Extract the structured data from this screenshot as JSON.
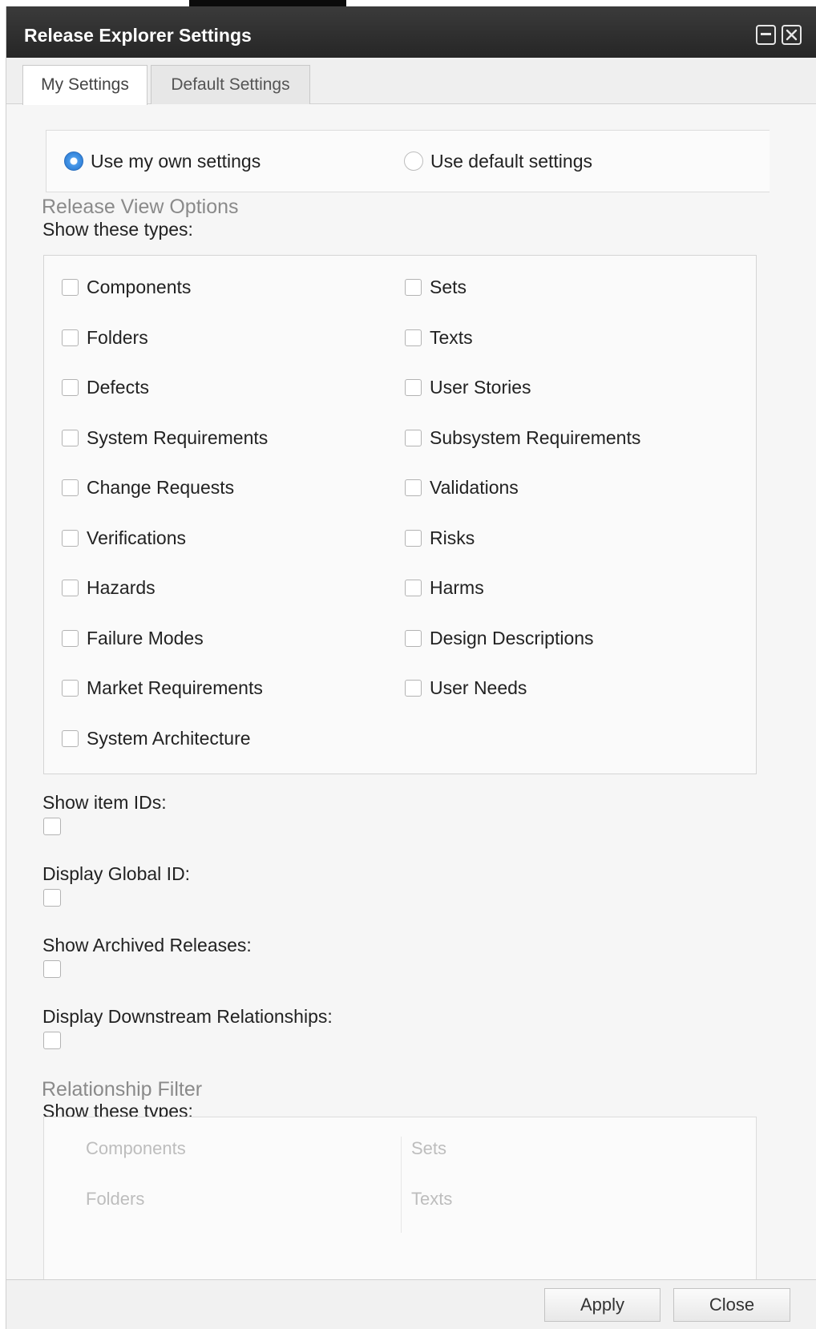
{
  "window": {
    "title": "Release Explorer Settings",
    "restore_icon": "restore-icon",
    "close_icon": "close-icon"
  },
  "tabs": [
    {
      "label": "My Settings",
      "active": true
    },
    {
      "label": "Default Settings",
      "active": false
    }
  ],
  "settings_mode": {
    "own": "Use my own settings",
    "default": "Use default settings",
    "selected": "own"
  },
  "release_view_options": {
    "title": "Release View Options",
    "subtitle": "Show these types:",
    "left": [
      "Components",
      "Folders",
      "Defects",
      "System Requirements",
      "Change Requests",
      "Verifications",
      "Hazards",
      "Failure Modes",
      "Market Requirements",
      "System Architecture"
    ],
    "right": [
      "Sets",
      "Texts",
      "User Stories",
      "Subsystem Requirements",
      "Validations",
      "Risks",
      "Harms",
      "Design Descriptions",
      "User Needs"
    ]
  },
  "options": {
    "show_item_ids": "Show item IDs:",
    "display_global_id": "Display Global ID:",
    "show_archived_releases": "Show Archived Releases:",
    "display_downstream_relationships": "Display Downstream Relationships:"
  },
  "relationship_filter": {
    "title": "Relationship Filter",
    "subtitle": "Show these types:",
    "left": [
      "Components",
      "Folders"
    ],
    "right": [
      "Sets",
      "Texts"
    ]
  },
  "footer": {
    "apply": "Apply",
    "close": "Close"
  }
}
